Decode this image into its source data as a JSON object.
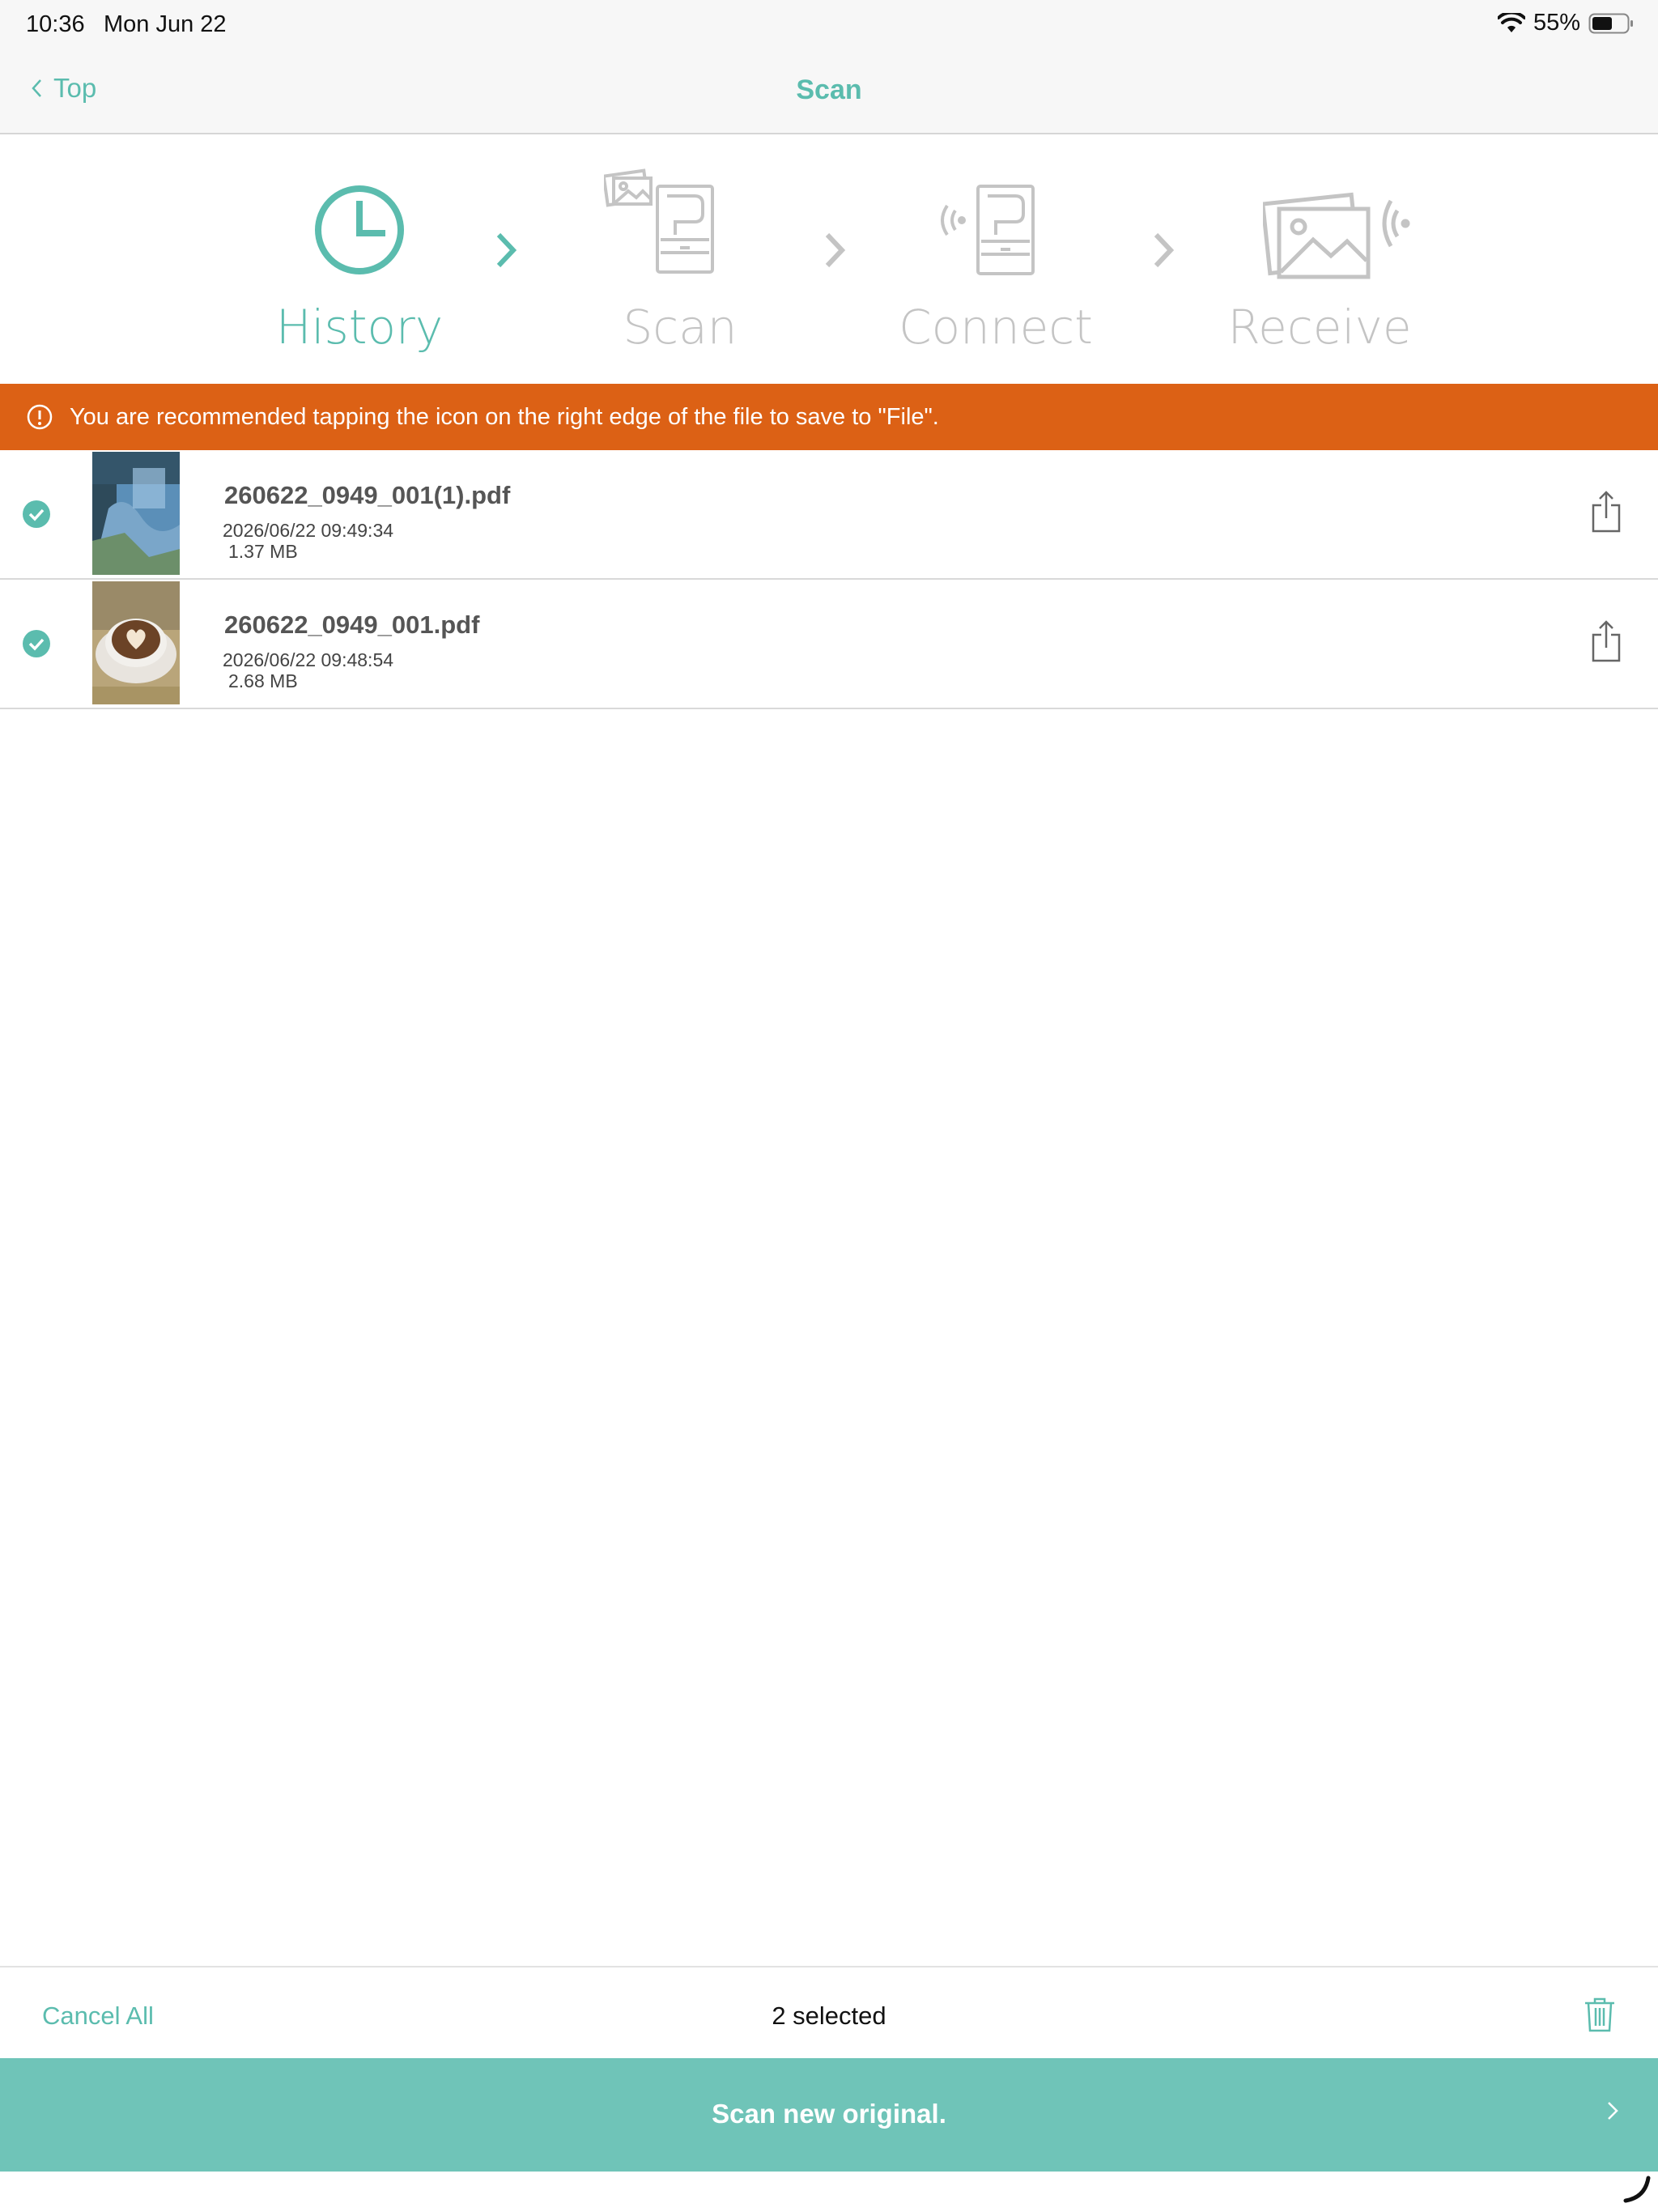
{
  "status_bar": {
    "time": "10:36",
    "date": "Mon Jun 22",
    "battery": "55%",
    "icons": [
      "wifi-icon",
      "battery-icon"
    ]
  },
  "navbar": {
    "back_label": "Top",
    "title": "Scan"
  },
  "steps": [
    {
      "label": "History",
      "icon": "clock-icon",
      "active": true
    },
    {
      "label": "Scan",
      "icon": "scanner-icon",
      "active": false
    },
    {
      "label": "Connect",
      "icon": "scanner-wireless-icon",
      "active": false
    },
    {
      "label": "Receive",
      "icon": "photo-receive-icon",
      "active": false
    }
  ],
  "banner": {
    "text": "You are recommended tapping the icon on the right edge of the file to save to \"File\".",
    "icon": "alert-circle-icon"
  },
  "files": [
    {
      "name": "260622_0949_001(1).pdf",
      "date": "2026/06/22 09:49:34",
      "size": "1.37 MB",
      "selected": true,
      "thumbnail": "landscape-photo"
    },
    {
      "name": "260622_0949_001.pdf",
      "date": "2026/06/22 09:48:54",
      "size": "2.68 MB",
      "selected": true,
      "thumbnail": "coffee-latte-photo"
    }
  ],
  "footer": {
    "cancel_all": "Cancel All",
    "selected_text": "2 selected"
  },
  "scan_new": {
    "label": "Scan new original."
  },
  "colors": {
    "accent": "#5bbcae",
    "banner": "#dc6115",
    "button": "#6fc4b8",
    "inactive": "#c4c4c4"
  }
}
